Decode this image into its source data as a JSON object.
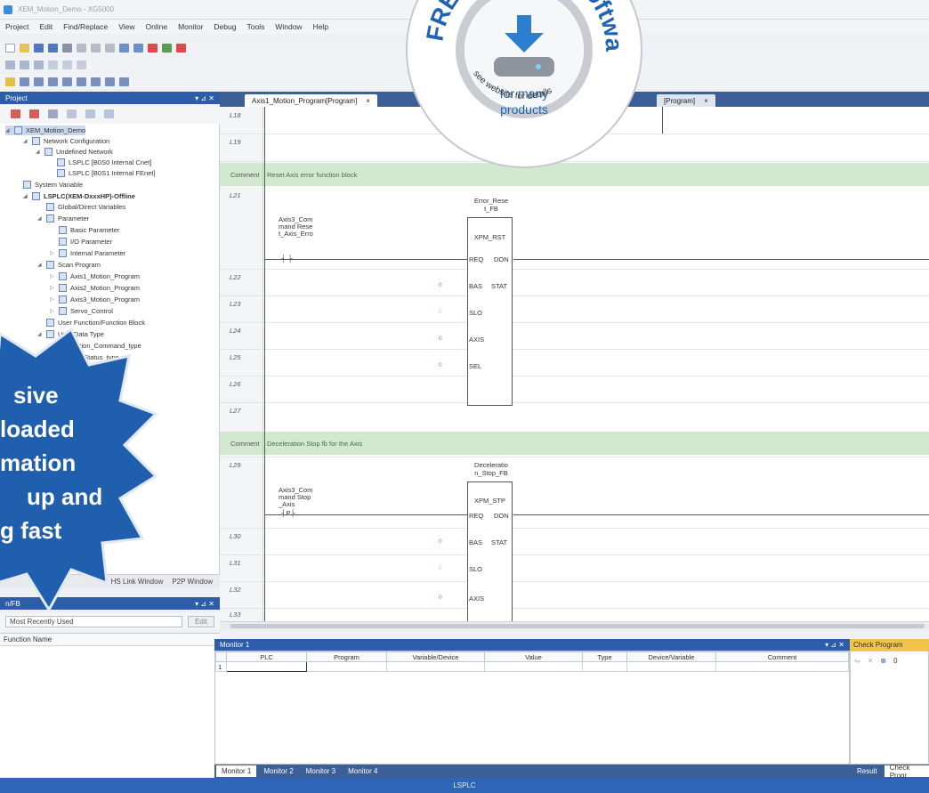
{
  "window": {
    "title": "XEM_Motion_Demo - XG5000"
  },
  "menu": [
    "Project",
    "Edit",
    "Find/Replace",
    "View",
    "Online",
    "Monitor",
    "Debug",
    "Tools",
    "Window",
    "Help"
  ],
  "project_panel": {
    "title": "Project",
    "tree": [
      {
        "label": "XEM_Motion_Demo",
        "icon": "project-icon",
        "bold": false,
        "selected": true
      },
      {
        "label": "Network Configuration",
        "icon": "network-icon"
      },
      {
        "label": "Undefined Network",
        "icon": "network-icon"
      },
      {
        "label": "LSPLC [B0S0 Internal Cnet]",
        "icon": "plc-icon"
      },
      {
        "label": "LSPLC [B0S1 Internal FEnet]",
        "icon": "plc-icon"
      },
      {
        "label": "System Variable",
        "icon": "variable-icon"
      },
      {
        "label": "LSPLC(XEM-DxxxHP)-Offline",
        "icon": "plc-icon",
        "bold": true
      },
      {
        "label": "Global/Direct Variables",
        "icon": "variable-icon"
      },
      {
        "label": "Parameter",
        "icon": "folder-icon"
      },
      {
        "label": "Basic Parameter",
        "icon": "parameter-icon"
      },
      {
        "label": "I/O Parameter",
        "icon": "parameter-icon"
      },
      {
        "label": "Internal Parameter",
        "icon": "parameter-icon"
      },
      {
        "label": "Scan Program",
        "icon": "folder-icon"
      },
      {
        "label": "Axis1_Motion_Program",
        "icon": "program-icon"
      },
      {
        "label": "Axis2_Motion_Program",
        "icon": "program-icon"
      },
      {
        "label": "Axis3_Motion_Program",
        "icon": "program-icon"
      },
      {
        "label": "Servo_Control",
        "icon": "program-icon"
      },
      {
        "label": "User Function/Function Block",
        "icon": "function-icon"
      },
      {
        "label": "User Data Type",
        "icon": "datatype-icon"
      },
      {
        "label": "Motion_Command_type",
        "icon": "datatype-icon"
      },
      {
        "label": "ion_Status_type",
        "icon": "datatype-icon"
      }
    ],
    "tabs": [
      "HS Link Window",
      "P2P Window"
    ]
  },
  "fb_panel": {
    "title": "n/FB",
    "combo_value": "Most Recently Used",
    "edit_label": "Edit",
    "column": "Function Name"
  },
  "editor": {
    "tabs": [
      {
        "label": "Axis1_Motion_Program[Program]",
        "active": true
      },
      {
        "label": "[Program]",
        "active": false
      }
    ],
    "lines": [
      "L18",
      "L19",
      "L21",
      "L22",
      "L23",
      "L24",
      "L25",
      "L26",
      "L27",
      "L29",
      "L30",
      "L31",
      "L32",
      "L33"
    ],
    "comment_label": "Comment",
    "comments": [
      "Reset Axis error function block",
      "Deceleration Stop fb for the Axis"
    ],
    "blocks": [
      {
        "instance": [
          "Error_Rese",
          "t_FB"
        ],
        "type": "XPM_RST",
        "contact": [
          "Axis3_Com",
          "mand Rese",
          "t_Axis_Erro"
        ],
        "contact_symbol": "┤ ├",
        "pins_left": [
          "REQ",
          "BAS",
          "SLO",
          "AXIS",
          "SEL"
        ],
        "pins_right": [
          "DON",
          "STAT"
        ],
        "values": [
          "0",
          "0",
          "0",
          "0"
        ]
      },
      {
        "instance": [
          "Deceleratio",
          "n_Stop_FB"
        ],
        "type": "XPM_STP",
        "contact": [
          "Axis3_Com",
          "mand Stop",
          "_Axis"
        ],
        "contact_symbol": "┤P├",
        "pins_left": [
          "REQ",
          "BAS",
          "SLO",
          "AXIS"
        ],
        "pins_right": [
          "DON",
          "STAT"
        ],
        "values": [
          "0",
          "0",
          "0"
        ]
      }
    ]
  },
  "monitor": {
    "title": "Monitor 1",
    "columns": [
      "PLC",
      "Program",
      "Variable/Device",
      "Value",
      "Type",
      "Device/Variable",
      "Comment"
    ],
    "row_number": "1",
    "tabs": [
      "Monitor 1",
      "Monitor 2",
      "Monitor 3",
      "Monitor 4"
    ]
  },
  "check_program": {
    "title": "Check Program",
    "count": "0",
    "tabs": [
      "Result",
      "Check Progr"
    ]
  },
  "status": {
    "text": "LSPLC"
  },
  "promo_badge": {
    "line1": "FREE Do",
    "line2": "Software",
    "middle": [
      "for many",
      "products"
    ],
    "bottom": "see website for details"
  },
  "promo_burst": {
    "lines": [
      "sive",
      "loaded",
      "mation",
      "up and",
      "g fast"
    ]
  },
  "colors": {
    "panel_header": "#2d5ca8",
    "comment_row": "#d3e9cf",
    "status_bar": "#2f65b8",
    "badge_blue": "#1e63b5",
    "burst_blue": "#1f5fae",
    "check_header": "#f1c34b"
  }
}
